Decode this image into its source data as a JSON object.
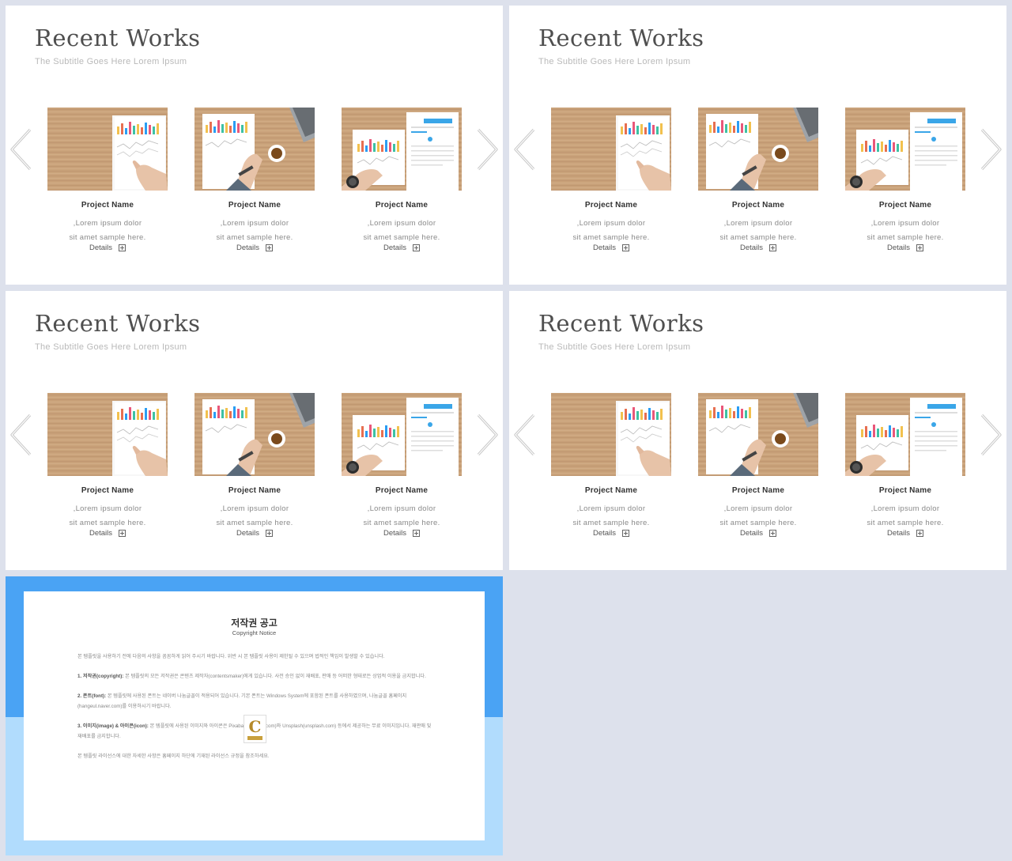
{
  "slides": [
    {
      "title": "Recent Works",
      "subtitle": "The Subtitle Goes Here Lorem Ipsum"
    },
    {
      "title": "Recent Works",
      "subtitle": "The Subtitle Goes Here Lorem Ipsum"
    },
    {
      "title": "Recent Works",
      "subtitle": "The Subtitle Goes Here Lorem Ipsum"
    },
    {
      "title": "Recent Works",
      "subtitle": "The Subtitle Goes Here Lorem Ipsum"
    }
  ],
  "card": {
    "name": "Project Name",
    "desc": ",Lorem ipsum dolor sit amet sample here.",
    "details": "Details"
  },
  "notice": {
    "title": "저작권 공고",
    "subtitle": "Copyright Notice",
    "p1": "본 템플릿을 사용하기 전에 다음의 사항을 꼼꼼하게 읽어 주시기 바랍니다. 위반 시 본 템플릿 사용이 제한될 수 있으며 법적인 책임이 발생할 수 있습니다.",
    "p2_label": "1. 저작권(copyright):",
    "p2": "본 템플릿의 모든 저작권은 콘텐츠 제작자(contentsmaker)에게 있습니다. 사전 승인 없이 재배포, 판매 등 어떠한 형태로든 상업적 이용을 금지합니다.",
    "p3_label": "2. 폰트(font):",
    "p3": "본 템플릿에 사용된 폰트는 네이버 나눔글꼴이 적용되어 있습니다. 기본 폰트는 Windows System에 포함된 폰트를 사용하였으며, 나눔글꼴 홈페이지(hangeul.naver.com)를 이용하시기 바랍니다.",
    "p4_label": "3. 이미지(image) & 아이콘(icon):",
    "p4": "본 템플릿에 사용된 이미지와 아이콘은 Pixabay(pixabay.com)와 Unsplash(unsplash.com) 등에서 제공하는 무료 이미지입니다. 재판매 및 재배포를 금지합니다.",
    "p5": "본 템플릿 라이선스에 대한 자세한 사항은 홈페이지 하단에 기재된 라이선스 규정을 참조하세요."
  },
  "colors": {
    "band_top": "#4aa3f4",
    "band_bottom": "#b1dcfd",
    "background": "#dde1ec"
  }
}
